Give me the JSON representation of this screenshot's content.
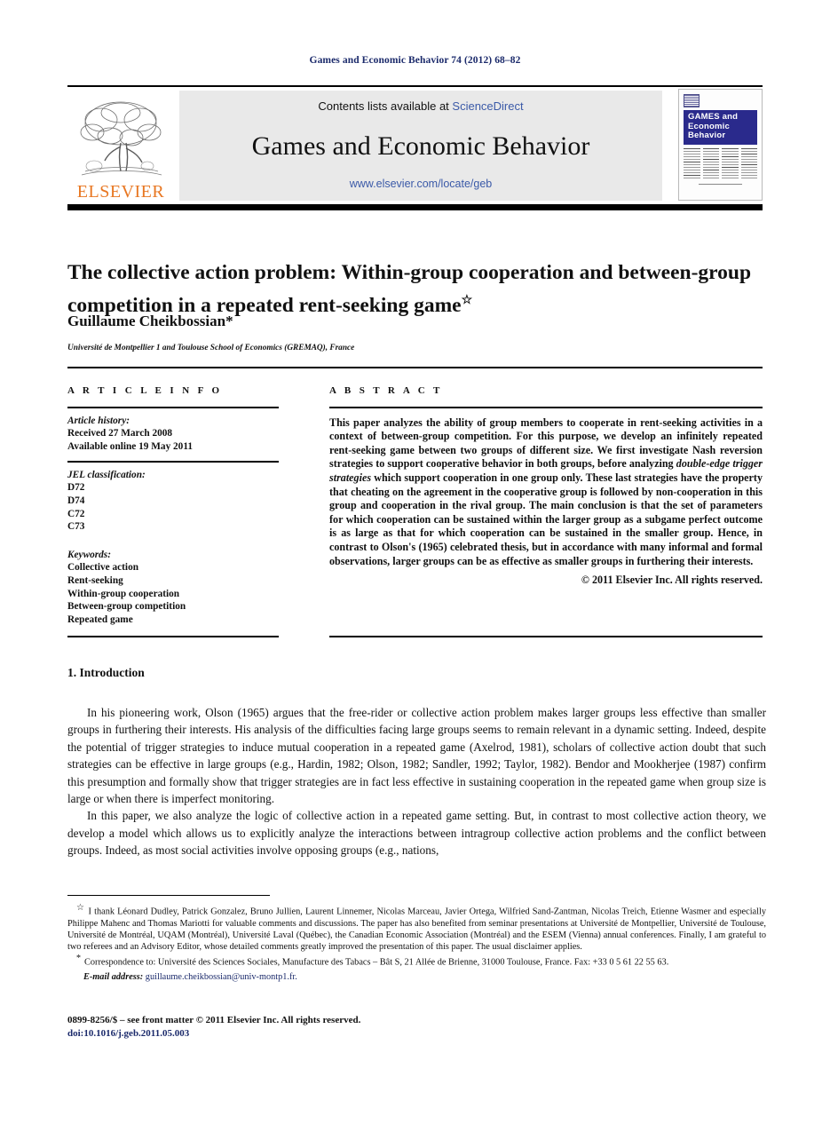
{
  "running_head": "Games and Economic Behavior 74 (2012) 68–82",
  "masthead": {
    "contents_text": "Contents lists available at ",
    "sciencedirect": "ScienceDirect",
    "journal_title": "Games and Economic Behavior",
    "journal_url": "www.elsevier.com/locate/geb",
    "publisher_wordmark": "ELSEVIER",
    "cover_title_line1": "GAMES and",
    "cover_title_line2": "Economic",
    "cover_title_line3": "Behavior",
    "link_color": "#3b5aa8",
    "wordmark_color": "#E87722",
    "cover_box_color": "#2a2a8c"
  },
  "article": {
    "title": "The collective action problem: Within-group cooperation and between-group competition in a repeated rent-seeking game",
    "title_footnote_mark": "☆",
    "author": "Guillaume Cheikbossian*",
    "affiliation": "Université de Montpellier 1 and Toulouse School of Economics (GREMAQ), France"
  },
  "article_info": {
    "heading": "A R T I C L E    I N F O",
    "history_label": "Article history:",
    "history": [
      "Received 27 March 2008",
      "Available online 19 May 2011"
    ],
    "jel_label": "JEL classification:",
    "jel_codes": [
      "D72",
      "D74",
      "C72",
      "C73"
    ],
    "keywords_label": "Keywords:",
    "keywords": [
      "Collective action",
      "Rent-seeking",
      "Within-group cooperation",
      "Between-group competition",
      "Repeated game"
    ]
  },
  "abstract": {
    "heading": "A B S T R A C T",
    "part1": "This paper analyzes the ability of group members to cooperate in rent-seeking activities in a context of between-group competition. For this purpose, we develop an infinitely repeated rent-seeking game between two groups of different size. We first investigate Nash reversion strategies to support cooperative behavior in both groups, before analyzing ",
    "emphasis": "double-edge trigger strategies",
    "part2": " which support cooperation in one group only. These last strategies have the property that cheating on the agreement in the cooperative group is followed by non-cooperation in this group and cooperation in the rival group. The main conclusion is that the set of parameters for which cooperation can be sustained within the larger group as a subgame perfect outcome is as large as that for which cooperation can be sustained in the smaller group. Hence, in contrast to Olson's (1965) celebrated thesis, but in accordance with many informal and formal observations, larger groups can be as effective as smaller groups in furthering their interests.",
    "copyright": "© 2011 Elsevier Inc. All rights reserved."
  },
  "body": {
    "section_number_title": "1. Introduction",
    "paragraph1": "In his pioneering work, Olson (1965) argues that the free-rider or collective action problem makes larger groups less effective than smaller groups in furthering their interests. His analysis of the difficulties facing large groups seems to remain relevant in a dynamic setting. Indeed, despite the potential of trigger strategies to induce mutual cooperation in a repeated game (Axelrod, 1981), scholars of collective action doubt that such strategies can be effective in large groups (e.g., Hardin, 1982; Olson, 1982; Sandler, 1992; Taylor, 1982). Bendor and Mookherjee (1987) confirm this presumption and formally show that trigger strategies are in fact less effective in sustaining cooperation in the repeated game when group size is large or when there is imperfect monitoring.",
    "paragraph2": "In this paper, we also analyze the logic of collective action in a repeated game setting. But, in contrast to most collective action theory, we develop a model which allows us to explicitly analyze the interactions between intragroup collective action problems and the conflict between groups. Indeed, as most social activities involve opposing groups (e.g., nations,"
  },
  "footnotes": {
    "star_mark": "☆",
    "acknowledgement": "I thank Léonard Dudley, Patrick Gonzalez, Bruno Jullien, Laurent Linnemer, Nicolas Marceau, Javier Ortega, Wilfried Sand-Zantman, Nicolas Treich, Etienne Wasmer and especially Philippe Mahenc and Thomas Mariotti for valuable comments and discussions. The paper has also benefited from seminar presentations at Université de Montpellier, Université de Toulouse, Université de Montréal, UQAM (Montréal), Université Laval (Québec), the Canadian Economic Association (Montréal) and the ESEM (Vienna) annual conferences. Finally, I am grateful to two referees and an Advisory Editor, whose detailed comments greatly improved the presentation of this paper. The usual disclaimer applies.",
    "correspondence_mark": "*",
    "correspondence": "Correspondence to: Université des Sciences Sociales, Manufacture des Tabacs – Bât S, 21 Allée de Brienne, 31000 Toulouse, France. Fax: +33 0 5 61 22 55 63.",
    "email_label": "E-mail address:",
    "email": "guillaume.cheikbossian@univ-montp1.fr."
  },
  "imprint": {
    "issn_line": "0899-8256/$ – see front matter  © 2011 Elsevier Inc. All rights reserved.",
    "doi": "doi:10.1016/j.geb.2011.05.003"
  }
}
